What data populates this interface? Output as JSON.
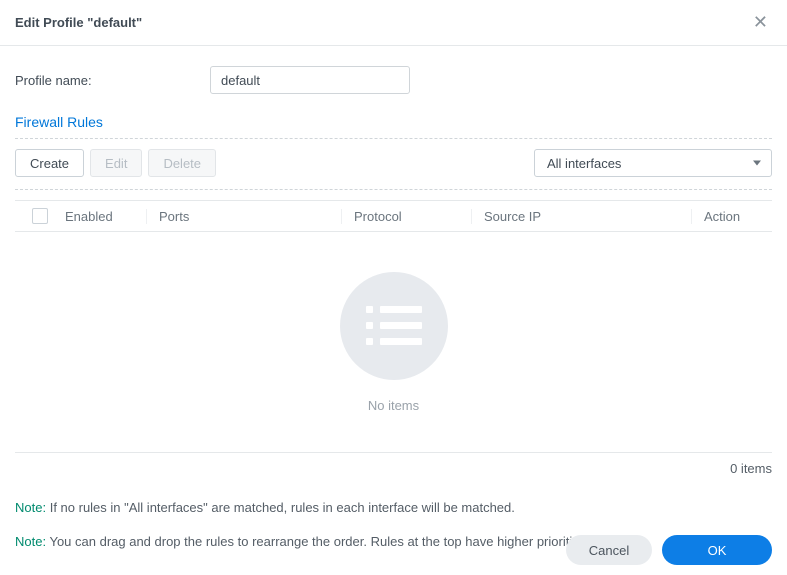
{
  "dialog": {
    "title": "Edit Profile \"default\""
  },
  "form": {
    "profile_name_label": "Profile name:",
    "profile_name_value": "default"
  },
  "section": {
    "heading": "Firewall Rules"
  },
  "toolbar": {
    "create": "Create",
    "edit": "Edit",
    "delete": "Delete",
    "interface_selected": "All interfaces"
  },
  "table": {
    "headers": {
      "enabled": "Enabled",
      "ports": "Ports",
      "protocol": "Protocol",
      "sourceip": "Source IP",
      "action": "Action"
    },
    "empty_text": "No items",
    "footer_count": "0 items"
  },
  "notes": {
    "label": "Note:",
    "note1": "If no rules in \"All interfaces\" are matched, rules in each interface will be matched.",
    "note2": "You can drag and drop the rules to rearrange the order. Rules at the top have higher priorities."
  },
  "buttons": {
    "cancel": "Cancel",
    "ok": "OK"
  }
}
